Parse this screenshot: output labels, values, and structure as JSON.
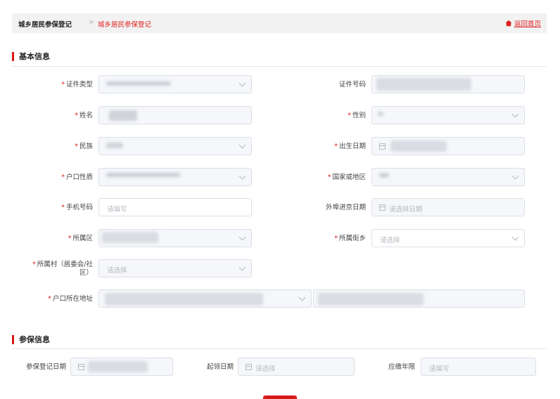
{
  "breadcrumb": {
    "root": "城乡居民参保登记",
    "separator": ">",
    "current": "城乡居民参保登记",
    "home": "返回首页"
  },
  "sections": {
    "basic": "基本信息",
    "insurance": "参保信息"
  },
  "fields": {
    "id_type": {
      "label": "证件类型",
      "required": "*"
    },
    "id_number": {
      "label": "证件号码"
    },
    "name": {
      "label": "姓名",
      "required": "*"
    },
    "gender": {
      "label": "性别",
      "required": "*"
    },
    "ethnicity": {
      "label": "民族",
      "required": "*"
    },
    "birth_date": {
      "label": "出生日期",
      "required": "*"
    },
    "hukou_type": {
      "label": "户口性质",
      "required": "*"
    },
    "country": {
      "label": "国家或地区",
      "required": "*"
    },
    "phone": {
      "label": "手机号码",
      "required": "*",
      "placeholder": "请填写"
    },
    "arrival_date": {
      "label": "外埠进京日期",
      "placeholder": "请选择日期"
    },
    "district": {
      "label": "所属区",
      "required": "*"
    },
    "street": {
      "label": "所属街乡",
      "required": "*",
      "placeholder": "请选择"
    },
    "village": {
      "label": "所属村（居委会/社区）",
      "required": "*",
      "placeholder": "请选择"
    },
    "address": {
      "label": "户口所在地址",
      "required": "*"
    },
    "reg_date": {
      "label": "参保登记日期"
    },
    "start_date": {
      "label": "起领日期",
      "placeholder": "请选择"
    },
    "years": {
      "label": "应缴年限",
      "placeholder": "请填写"
    }
  },
  "colors": {
    "accent": "#d7191c",
    "link": "#e02020"
  }
}
